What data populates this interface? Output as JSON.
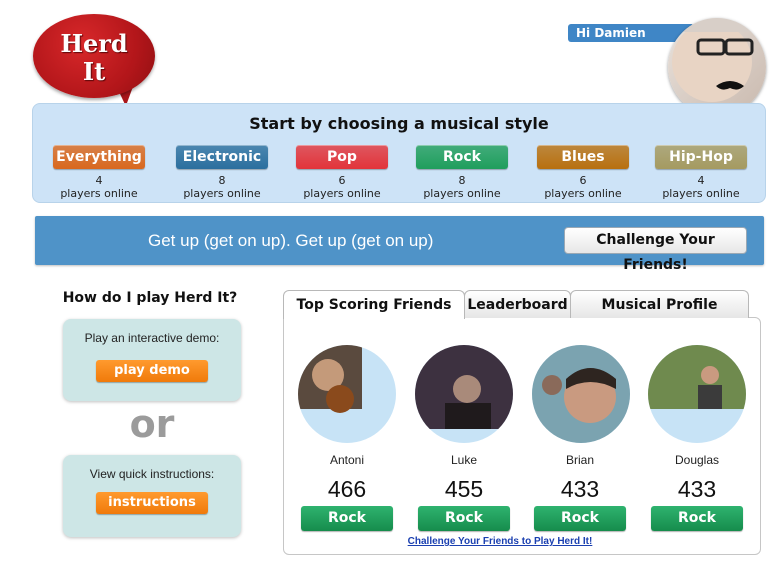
{
  "logo": {
    "line1": "Herd",
    "line2": "It"
  },
  "user": {
    "greeting": "Hi  Damien"
  },
  "style_chooser": {
    "title": "Start by choosing a musical style",
    "players_label": "players online",
    "genres": [
      {
        "name": "Everything",
        "count": "4",
        "color": "#d9681e"
      },
      {
        "name": "Electronic",
        "count": "8",
        "color": "#2b6f9e"
      },
      {
        "name": "Pop",
        "count": "6",
        "color": "#e2343a"
      },
      {
        "name": "Rock",
        "count": "8",
        "color": "#1f9e5c"
      },
      {
        "name": "Blues",
        "count": "6",
        "color": "#b8700f"
      },
      {
        "name": "Hip-Hop",
        "count": "4",
        "color": "#a59a60"
      }
    ]
  },
  "banner": {
    "text": "Get up (get on up).  Get up (get on up)",
    "button": "Challenge Your Friends!"
  },
  "help": {
    "title": "How do I play Herd It?",
    "demo_text": "Play an interactive demo:",
    "demo_button": "play demo",
    "or": "or",
    "instructions_text": "View quick instructions:",
    "instructions_button": "instructions"
  },
  "tabs": [
    "Top Scoring Friends",
    "Leaderboard",
    "Musical Profile"
  ],
  "friends": [
    {
      "name": "Antoni",
      "score": "466",
      "genre": "Rock"
    },
    {
      "name": "Luke",
      "score": "455",
      "genre": "Rock"
    },
    {
      "name": "Brian",
      "score": "433",
      "genre": "Rock"
    },
    {
      "name": "Douglas",
      "score": "433",
      "genre": "Rock"
    }
  ],
  "challenge_link": "Challenge Your Friends to Play Herd It!"
}
